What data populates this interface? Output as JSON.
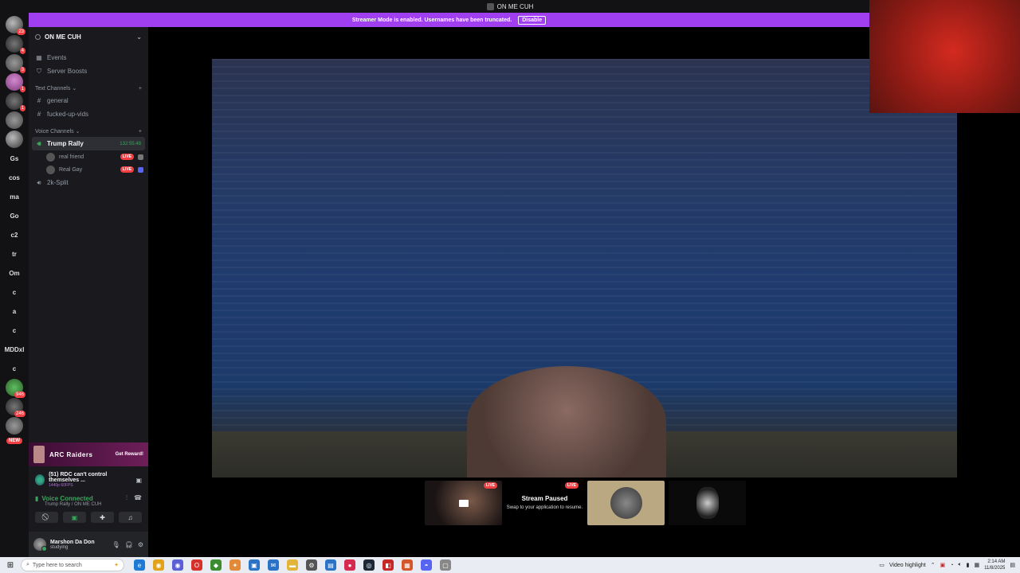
{
  "window": {
    "title": "ON ME CUH"
  },
  "banner": {
    "text": "Streamer Mode is enabled. Usernames have been truncated.",
    "button": "Disable"
  },
  "rail": {
    "servers": [
      {
        "label": "",
        "style": "img1",
        "badge": "23"
      },
      {
        "label": "",
        "style": "img4",
        "badge": "4"
      },
      {
        "label": "",
        "style": "img2",
        "badge": "3"
      },
      {
        "label": "",
        "style": "img3",
        "badge": "1"
      },
      {
        "label": "",
        "style": "img4",
        "badge": "1"
      },
      {
        "label": "",
        "style": "img2",
        "badge": ""
      },
      {
        "label": "",
        "style": "img1",
        "badge": ""
      },
      {
        "label": "Gs",
        "style": "txt",
        "badge": ""
      },
      {
        "label": "cos",
        "style": "txt",
        "badge": ""
      },
      {
        "label": "ma",
        "style": "txt",
        "badge": ""
      },
      {
        "label": "Go",
        "style": "txt",
        "badge": ""
      },
      {
        "label": "c2",
        "style": "txt",
        "badge": ""
      },
      {
        "label": "tr",
        "style": "txt",
        "badge": ""
      },
      {
        "label": "Om",
        "style": "txt",
        "badge": ""
      },
      {
        "label": "c",
        "style": "txt",
        "badge": ""
      },
      {
        "label": "a",
        "style": "txt",
        "badge": ""
      },
      {
        "label": "c",
        "style": "txt",
        "badge": ""
      },
      {
        "label": "MDDxl",
        "style": "txt",
        "badge": ""
      },
      {
        "label": "c",
        "style": "txt",
        "badge": ""
      },
      {
        "label": "",
        "style": "img5",
        "badge": "946"
      },
      {
        "label": "",
        "style": "img4",
        "badge": "246"
      },
      {
        "label": "",
        "style": "img2",
        "badge": ""
      }
    ],
    "new_badge": "NEW"
  },
  "sidebar": {
    "server_name": "ON ME CUH",
    "top_items": [
      {
        "icon": "▦",
        "label": "Events"
      },
      {
        "icon": "⛉",
        "label": "Server Boosts"
      }
    ],
    "text_category": "Text Channels",
    "text_channels": [
      "general",
      "fucked-up-vids"
    ],
    "voice_category": "Voice Channels",
    "voice_active": {
      "name": "Trump Rally",
      "timer": "132:55:48"
    },
    "voice_users": [
      {
        "name": "real friend",
        "live": "LIVE"
      },
      {
        "name": "Real Gay",
        "live": "LIVE"
      }
    ],
    "voice_other": "2k-Split"
  },
  "promo": {
    "logo": "ARC Raiders",
    "button": "Get Reward!"
  },
  "activity": {
    "title": "(51) RDC can't control themselves ...",
    "subtitle": "1440p 60FPS"
  },
  "voice_panel": {
    "status": "Voice Connected",
    "location": "Trump Rally / ON ME CUH"
  },
  "user": {
    "name": "Marshon Da Don",
    "status": "studying"
  },
  "tiles": {
    "live_label": "LIVE",
    "paused_title": "Stream Paused",
    "paused_sub": "Swap to your application to resume."
  },
  "taskbar": {
    "search_placeholder": "Type here to search",
    "video_highlight": "Video highlight",
    "time": "2:14 AM",
    "date": "11/8/2025",
    "apps": [
      {
        "name": "edge-icon",
        "color": "#1f7ad6",
        "glyph": "e"
      },
      {
        "name": "chrome-icon",
        "color": "#e2a21b",
        "glyph": "◉"
      },
      {
        "name": "chrome-alt-icon",
        "color": "#5b5fd6",
        "glyph": "◉"
      },
      {
        "name": "opera-icon",
        "color": "#d6322b",
        "glyph": "O"
      },
      {
        "name": "game-icon",
        "color": "#3b8d2f",
        "glyph": "◆"
      },
      {
        "name": "pinned-app-icon",
        "color": "#e28a3a",
        "glyph": "✦"
      },
      {
        "name": "window-icon",
        "color": "#2a73c7",
        "glyph": "▣"
      },
      {
        "name": "mail-icon",
        "color": "#2a73c7",
        "glyph": "✉"
      },
      {
        "name": "folder-icon",
        "color": "#e2b43a",
        "glyph": "▬"
      },
      {
        "name": "settings-icon",
        "color": "#555555",
        "glyph": "⚙"
      },
      {
        "name": "store-icon",
        "color": "#2a73c7",
        "glyph": "▤"
      },
      {
        "name": "record-icon",
        "color": "#d62b4e",
        "glyph": "●"
      },
      {
        "name": "steam-icon",
        "color": "#1b2838",
        "glyph": "◎"
      },
      {
        "name": "roblox-icon",
        "color": "#c62828",
        "glyph": "◧"
      },
      {
        "name": "ms-icon",
        "color": "#d6562b",
        "glyph": "▦"
      },
      {
        "name": "discord-icon",
        "color": "#5865f2",
        "glyph": "◓"
      },
      {
        "name": "capture-icon",
        "color": "#888888",
        "glyph": "▢"
      }
    ]
  },
  "colors": {
    "accent": "#a03ff0",
    "voice_green": "#3ba55d",
    "live_red": "#f23f43"
  }
}
